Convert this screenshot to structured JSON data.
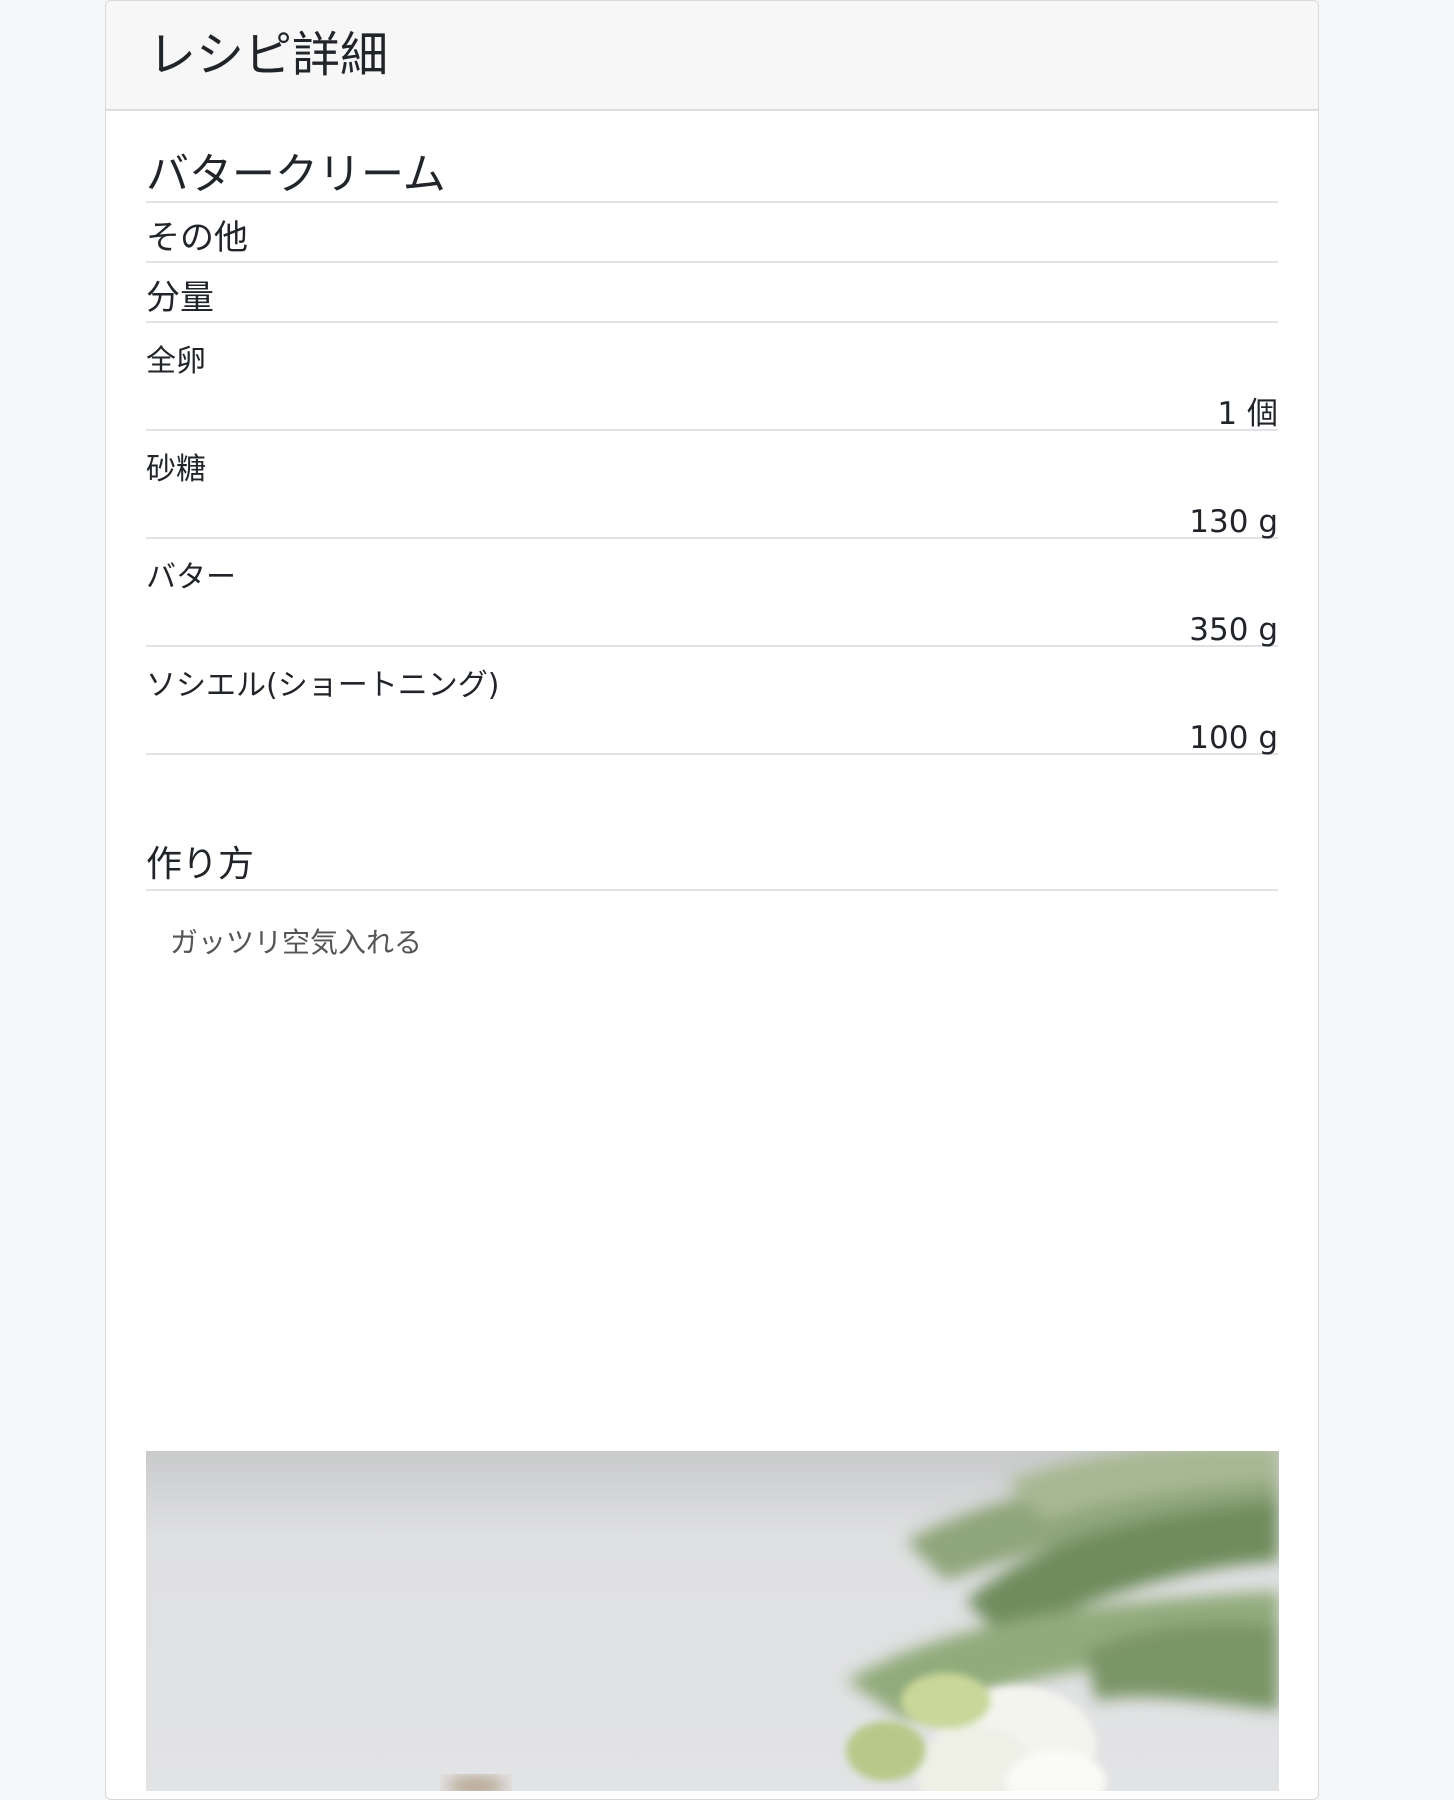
{
  "header": {
    "title": "レシピ詳細"
  },
  "recipe": {
    "name": "バタークリーム",
    "category": "その他",
    "amount_heading": "分量",
    "ingredients": [
      {
        "name": "全卵",
        "quantity": "1 個"
      },
      {
        "name": "砂糖",
        "quantity": "130 g"
      },
      {
        "name": "バター",
        "quantity": "350 g"
      },
      {
        "name": "ソシエル(ショートニング)",
        "quantity": "100 g"
      }
    ],
    "method_heading": "作り方",
    "method_text": "ガッツリ空気入れる"
  },
  "photo": {
    "subject": "white tulips with green leaves"
  },
  "colors": {
    "page_bg": "#f5f6f8",
    "header_bg": "#f7f7f7",
    "divider": "#dee2e6",
    "text": "#212529",
    "muted_text": "#555555"
  }
}
